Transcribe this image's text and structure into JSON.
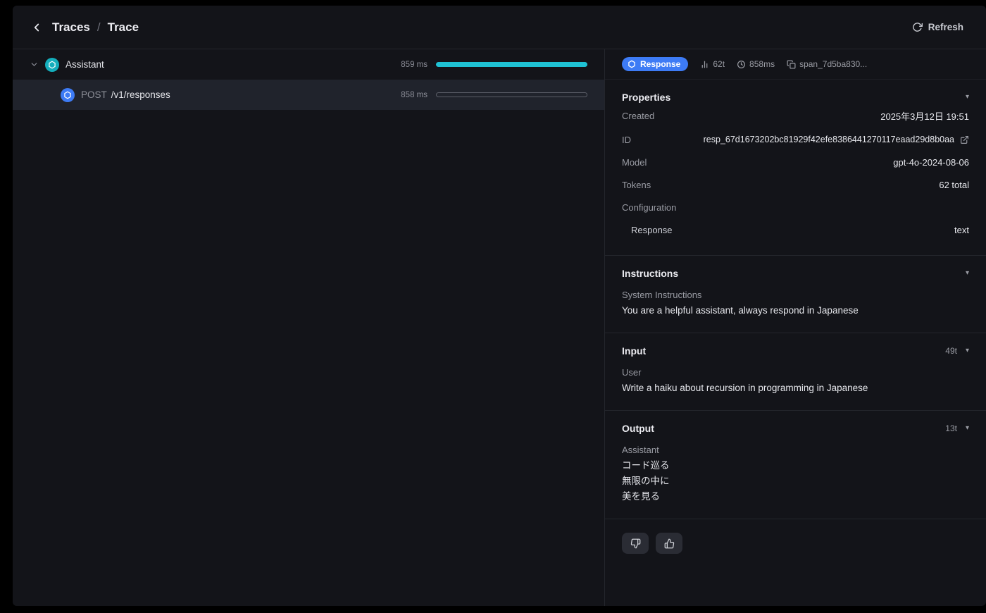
{
  "header": {
    "breadcrumb": {
      "parent": "Traces",
      "separator": "/",
      "current": "Trace"
    },
    "refresh_label": "Refresh"
  },
  "tree": {
    "rows": [
      {
        "label": "Assistant",
        "duration": "859 ms"
      },
      {
        "method": "POST",
        "path": "/v1/responses",
        "duration": "858 ms"
      }
    ]
  },
  "detail": {
    "meta": {
      "badge_label": "Response",
      "tokens": "62t",
      "duration": "858ms",
      "span_id": "span_7d5ba830..."
    },
    "properties": {
      "title": "Properties",
      "rows": [
        {
          "label": "Created",
          "value": "2025年3月12日 19:51"
        },
        {
          "label": "ID",
          "value": "resp_67d1673202bc81929f42efe8386441270117eaad29d8b0aa"
        },
        {
          "label": "Model",
          "value": "gpt-4o-2024-08-06"
        },
        {
          "label": "Tokens",
          "value": "62 total"
        }
      ],
      "configuration": {
        "label": "Configuration",
        "rows": [
          {
            "label": "Response",
            "value": "text"
          }
        ]
      }
    },
    "instructions": {
      "title": "Instructions",
      "role": "System Instructions",
      "text": "You are a helpful assistant, always respond in Japanese"
    },
    "input": {
      "title": "Input",
      "tokens": "49t",
      "role": "User",
      "text": "Write a haiku about recursion in programming in Japanese"
    },
    "output": {
      "title": "Output",
      "tokens": "13t",
      "role": "Assistant",
      "lines": [
        "コード巡る",
        "無限の中に",
        "美を見る"
      ]
    }
  },
  "colors": {
    "accent_blue": "#3d7bf5",
    "accent_teal": "#1fc2d4",
    "background": "#131419",
    "selected_row": "#20232c"
  }
}
